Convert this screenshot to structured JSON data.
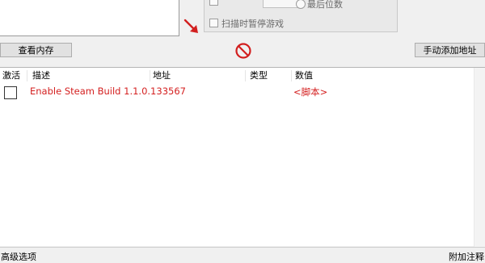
{
  "scan_panel": {
    "last_digits_label": "最后位数",
    "pause_game_label": "扫描时暂停游戏"
  },
  "buttons": {
    "view_memory": "查看内存",
    "add_address_manually": "手动添加地址"
  },
  "address_list": {
    "columns": [
      "激活",
      "描述",
      "地址",
      "类型",
      "数值"
    ],
    "rows": [
      {
        "active": false,
        "description": "Enable Steam Build 1.1.0.133567",
        "address": "",
        "type": "",
        "value": "<脚本>"
      }
    ]
  },
  "status_bar": {
    "advanced_options": "高级选项",
    "add_comment": "附加注释"
  },
  "colors": {
    "script_entry_text": "#d42020",
    "arrow": "#d21f1f",
    "clear_icon": "#d21f1f"
  },
  "icons": {
    "arrow_button": "red-diagonal-arrow-icon",
    "clear_button": "no-entry-icon"
  }
}
